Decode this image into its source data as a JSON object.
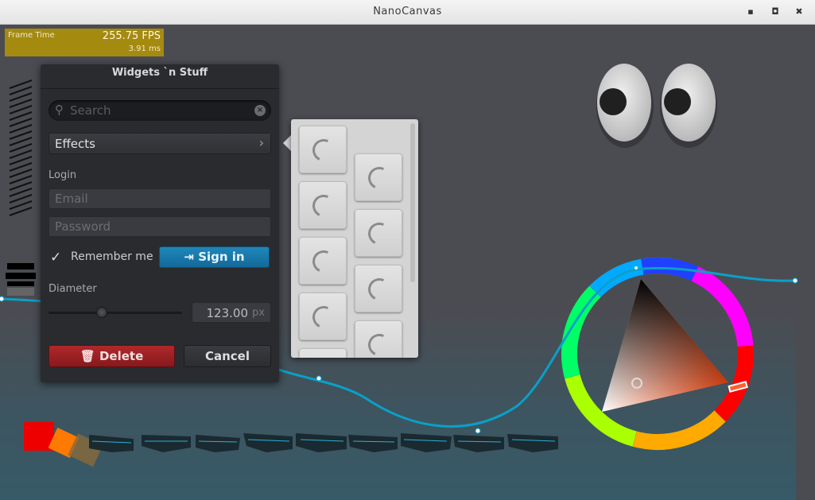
{
  "window": {
    "title": "NanoCanvas",
    "minimize": "▪",
    "maximize": "◘",
    "close": "✖"
  },
  "perf": {
    "label": "Frame Time",
    "fps": "255.75 FPS",
    "ms": "3.91 ms"
  },
  "panel": {
    "title": "Widgets `n Stuff",
    "search_placeholder": "Search",
    "effects_label": "Effects",
    "login_label": "Login",
    "email_placeholder": "Email",
    "password_placeholder": "Password",
    "remember_label": "Remember me",
    "remember_checked": true,
    "signin_label": "Sign in",
    "diameter_label": "Diameter",
    "diameter_value": "123.00",
    "diameter_unit": "px",
    "slider_fraction": 0.4,
    "delete_label": "Delete",
    "cancel_label": "Cancel"
  },
  "colors": {
    "accent_blue": "#1a7cb0",
    "delete_red": "#a02326",
    "fps_bg": "#a58a10",
    "curve": "#0aa0c8"
  },
  "icons": [
    "search-icon",
    "clear-icon",
    "chevron-right-icon",
    "checkmark-icon",
    "login-icon",
    "trash-icon"
  ]
}
